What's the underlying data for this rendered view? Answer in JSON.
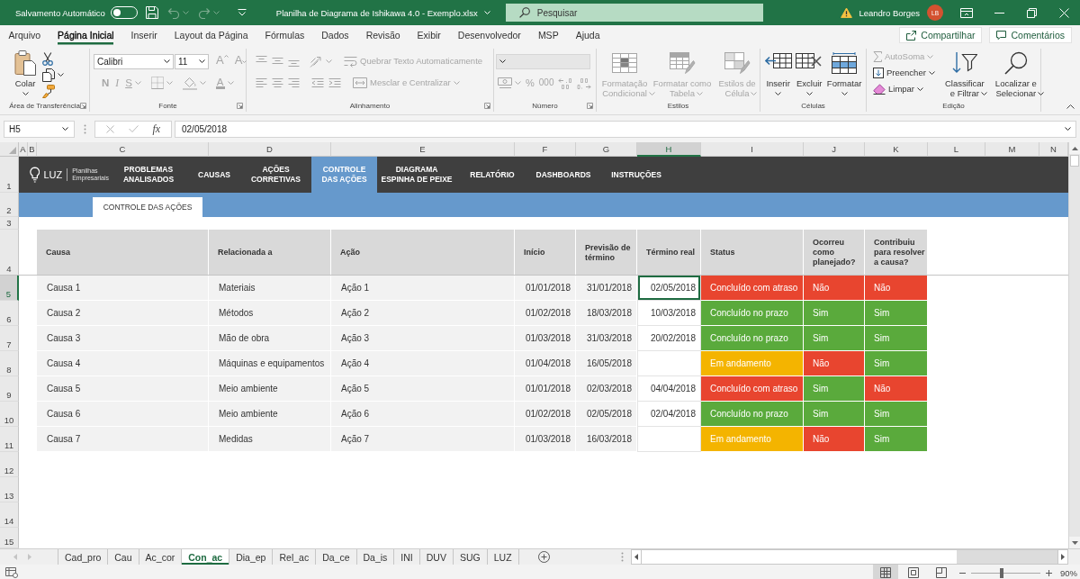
{
  "title_bar": {
    "autosave": {
      "label": "Salvamento Automático",
      "on": false
    },
    "quick_access": [
      {
        "kind": "save",
        "disabled": false
      },
      {
        "kind": "undo",
        "disabled": true
      },
      {
        "kind": "redo",
        "disabled": true
      },
      {
        "kind": "customize",
        "disabled": false
      }
    ],
    "title": "Planilha de Diagrama de Ishikawa 4.0 - Exemplo.xlsx",
    "search": {
      "placeholder": "Pesquisar"
    },
    "user": {
      "name": "Leandro Borges",
      "initials": "LB"
    }
  },
  "ribbon_tabs": [
    {
      "label": "Arquivo",
      "selected": false
    },
    {
      "label": "Página Inicial",
      "selected": true
    },
    {
      "label": "Inserir",
      "selected": false
    },
    {
      "label": "Layout da Página",
      "selected": false
    },
    {
      "label": "Fórmulas",
      "selected": false
    },
    {
      "label": "Dados",
      "selected": false
    },
    {
      "label": "Revisão",
      "selected": false
    },
    {
      "label": "Exibir",
      "selected": false
    },
    {
      "label": "Desenvolvedor",
      "selected": false
    },
    {
      "label": "MSP",
      "selected": false
    },
    {
      "label": "Ajuda",
      "selected": false
    }
  ],
  "share_button": "Compartilhar",
  "comments_button": "Comentários",
  "ribbon": {
    "groups": [
      {
        "kind": "stack",
        "label": "Área de Transferência",
        "launcher": true,
        "controls": [
          {
            "kind": "paste",
            "label": "Colar",
            "disabled": false
          },
          {
            "kind": "cut",
            "disabled": false
          },
          {
            "kind": "copy",
            "disabled": false
          },
          {
            "kind": "format-painter",
            "disabled": false
          }
        ]
      },
      {
        "kind": "rows",
        "label": "Fonte",
        "launcher": true,
        "controls": [
          {
            "kind": "font-name",
            "value": "Calibri",
            "disabled": false
          },
          {
            "kind": "font-size",
            "value": "11",
            "disabled": false
          },
          {
            "kind": "grow-font",
            "label": "A",
            "disabled": true
          },
          {
            "kind": "shrink-font",
            "label": "A",
            "disabled": true
          },
          {
            "kind": "bold",
            "label": "N",
            "disabled": true
          },
          {
            "kind": "italic",
            "label": "I",
            "disabled": true
          },
          {
            "kind": "underline",
            "label": "S",
            "disabled": true
          },
          {
            "kind": "borders",
            "disabled": true
          },
          {
            "kind": "fill-color",
            "disabled": true
          },
          {
            "kind": "font-color",
            "label": "A",
            "disabled": true
          }
        ]
      },
      {
        "kind": "rows",
        "label": "Alinhamento",
        "launcher": true,
        "controls": [
          {
            "kind": "align-top",
            "disabled": true
          },
          {
            "kind": "align-middle",
            "disabled": true
          },
          {
            "kind": "align-bottom",
            "disabled": true
          },
          {
            "kind": "orientation",
            "disabled": true
          },
          {
            "kind": "wrap-text",
            "label": "Quebrar Texto Automaticamente",
            "disabled": true
          },
          {
            "kind": "align-left",
            "disabled": true
          },
          {
            "kind": "align-center",
            "disabled": true
          },
          {
            "kind": "align-right",
            "disabled": true
          },
          {
            "kind": "indent-decrease",
            "disabled": true
          },
          {
            "kind": "indent-increase",
            "disabled": true
          },
          {
            "kind": "merge",
            "label": "Mesclar e Centralizar",
            "disabled": true
          }
        ]
      },
      {
        "kind": "rows",
        "label": "Número",
        "launcher": true,
        "controls": [
          {
            "kind": "number-format",
            "disabled": true
          },
          {
            "kind": "currency",
            "disabled": true
          },
          {
            "kind": "percent",
            "label": "%",
            "disabled": true
          },
          {
            "kind": "thousands",
            "label": "000",
            "disabled": true
          },
          {
            "kind": "decimal-increase",
            "disabled": true
          },
          {
            "kind": "decimal-decrease",
            "disabled": true
          }
        ]
      },
      {
        "kind": "stack",
        "label": "Estilos",
        "launcher": false,
        "controls": [
          {
            "kind": "cond-format",
            "label": "Formatação Condicional",
            "disabled": true
          },
          {
            "kind": "table-format",
            "label": "Formatar como Tabela",
            "disabled": true
          },
          {
            "kind": "cell-styles",
            "label": "Estilos de Célula",
            "disabled": true
          }
        ]
      },
      {
        "kind": "stack",
        "label": "Células",
        "launcher": false,
        "controls": [
          {
            "kind": "insert",
            "label": "Inserir",
            "disabled": false
          },
          {
            "kind": "delete",
            "label": "Excluir",
            "disabled": false
          },
          {
            "kind": "format",
            "label": "Formatar",
            "disabled": false
          }
        ]
      },
      {
        "kind": "stack",
        "label": "Edição",
        "launcher": false,
        "controls": [
          {
            "kind": "autosum",
            "label": "AutoSoma",
            "disabled": true
          },
          {
            "kind": "fill",
            "label": "Preencher",
            "disabled": false
          },
          {
            "kind": "clear",
            "label": "Limpar",
            "disabled": false
          },
          {
            "kind": "sort-filter",
            "label": "Classificar e Filtrar",
            "disabled": false
          },
          {
            "kind": "find",
            "label": "Localizar e Selecionar",
            "disabled": false
          }
        ]
      }
    ]
  },
  "formula_bar": {
    "name_box": "H5",
    "buttons": [
      {
        "kind": "cancel",
        "disabled": true
      },
      {
        "kind": "enter",
        "disabled": true
      },
      {
        "kind": "function",
        "label": "fx",
        "disabled": false
      }
    ],
    "value": "02/05/2018"
  },
  "sheet": {
    "columns": [
      {
        "label": "A",
        "selected": false
      },
      {
        "label": "B",
        "selected": false
      },
      {
        "label": "C",
        "selected": false
      },
      {
        "label": "D",
        "selected": false
      },
      {
        "label": "E",
        "selected": false
      },
      {
        "label": "F",
        "selected": false
      },
      {
        "label": "G",
        "selected": false
      },
      {
        "label": "H",
        "selected": true
      },
      {
        "label": "I",
        "selected": false
      },
      {
        "label": "J",
        "selected": false
      },
      {
        "label": "K",
        "selected": false
      },
      {
        "label": "L",
        "selected": false
      },
      {
        "label": "M",
        "selected": false
      },
      {
        "label": "N",
        "selected": false
      }
    ],
    "rows": [
      {
        "label": "1",
        "selected": false
      },
      {
        "label": "2",
        "selected": false
      },
      {
        "label": "3",
        "selected": false
      },
      {
        "label": "4",
        "selected": false
      },
      {
        "label": "5",
        "selected": true
      },
      {
        "label": "6",
        "selected": false
      },
      {
        "label": "7",
        "selected": false
      },
      {
        "label": "8",
        "selected": false
      },
      {
        "label": "9",
        "selected": false
      },
      {
        "label": "10",
        "selected": false
      },
      {
        "label": "11",
        "selected": false
      },
      {
        "label": "12",
        "selected": false
      },
      {
        "label": "13",
        "selected": false
      },
      {
        "label": "14",
        "selected": false
      },
      {
        "label": "15",
        "selected": false
      }
    ],
    "nav_bar": {
      "logo": {
        "name": "LUZ",
        "tagline": "Planilhas Empresariais"
      },
      "items": [
        {
          "label": "PROBLEMAS ANALISADOS",
          "selected": false
        },
        {
          "label": "CAUSAS",
          "selected": false
        },
        {
          "label": "AÇÕES CORRETIVAS",
          "selected": false
        },
        {
          "label": "CONTROLE DAS AÇÕES",
          "selected": true
        },
        {
          "label": "DIAGRAMA ESPINHA DE PEIXE",
          "selected": false
        },
        {
          "label": "RELATÓRIO",
          "selected": false
        },
        {
          "label": "DASHBOARDS",
          "selected": false
        },
        {
          "label": "INSTRUÇÕES",
          "selected": false
        }
      ]
    },
    "page_tab": "CONTROLE DAS AÇÕES",
    "table": {
      "columns": [
        "Causa",
        "Relacionada a",
        "Ação",
        "Início",
        "Previsão de término",
        "Término real",
        "Status",
        "Ocorreu como planejado?",
        "Contribuiu para resolver a causa?"
      ],
      "rows": [
        {
          "cause": "Causa 1",
          "related_to": "Materiais",
          "action": "Ação 1",
          "start": "01/01/2018",
          "forecast": "31/01/2018",
          "end": {
            "value": "02/05/2018",
            "selected": true
          },
          "status": {
            "text": "Concluído com atraso",
            "color": "#e8452f"
          },
          "as_planned": {
            "text": "Não",
            "color": "#e8452f"
          },
          "resolved": {
            "text": "Não",
            "color": "#e8452f"
          }
        },
        {
          "cause": "Causa 2",
          "related_to": "Métodos",
          "action": "Ação 2",
          "start": "01/02/2018",
          "forecast": "18/03/2018",
          "end": {
            "value": "10/03/2018",
            "selected": false
          },
          "status": {
            "text": "Concluído no prazo",
            "color": "#5aaa3c"
          },
          "as_planned": {
            "text": "Sim",
            "color": "#5aaa3c"
          },
          "resolved": {
            "text": "Sim",
            "color": "#5aaa3c"
          }
        },
        {
          "cause": "Causa 3",
          "related_to": "Mão de obra",
          "action": "Ação 3",
          "start": "01/03/2018",
          "forecast": "31/03/2018",
          "end": {
            "value": "20/02/2018",
            "selected": false
          },
          "status": {
            "text": "Concluído no prazo",
            "color": "#5aaa3c"
          },
          "as_planned": {
            "text": "Sim",
            "color": "#5aaa3c"
          },
          "resolved": {
            "text": "Sim",
            "color": "#5aaa3c"
          }
        },
        {
          "cause": "Causa 4",
          "related_to": "Máquinas e equipamentos",
          "action": "Ação 4",
          "start": "01/04/2018",
          "forecast": "16/05/2018",
          "end": {
            "selected": false
          },
          "status": {
            "text": "Em andamento",
            "color": "#f4b400"
          },
          "as_planned": {
            "text": "Não",
            "color": "#e8452f"
          },
          "resolved": {
            "text": "Sim",
            "color": "#5aaa3c"
          }
        },
        {
          "cause": "Causa 5",
          "related_to": "Meio ambiente",
          "action": "Ação 5",
          "start": "01/01/2018",
          "forecast": "02/03/2018",
          "end": {
            "value": "04/04/2018",
            "selected": false
          },
          "status": {
            "text": "Concluído com atraso",
            "color": "#e8452f"
          },
          "as_planned": {
            "text": "Sim",
            "color": "#5aaa3c"
          },
          "resolved": {
            "text": "Não",
            "color": "#e8452f"
          }
        },
        {
          "cause": "Causa 6",
          "related_to": "Meio ambiente",
          "action": "Ação 6",
          "start": "01/02/2018",
          "forecast": "02/05/2018",
          "end": {
            "value": "02/04/2018",
            "selected": false
          },
          "status": {
            "text": "Concluído no prazo",
            "color": "#5aaa3c"
          },
          "as_planned": {
            "text": "Sim",
            "color": "#5aaa3c"
          },
          "resolved": {
            "text": "Sim",
            "color": "#5aaa3c"
          }
        },
        {
          "cause": "Causa 7",
          "related_to": "Medidas",
          "action": "Ação 7",
          "start": "01/03/2018",
          "forecast": "16/03/2018",
          "end": {
            "selected": false
          },
          "status": {
            "text": "Em andamento",
            "color": "#f4b400"
          },
          "as_planned": {
            "text": "Não",
            "color": "#e8452f"
          },
          "resolved": {
            "text": "Sim",
            "color": "#5aaa3c"
          }
        }
      ]
    }
  },
  "sheet_tabs": {
    "nav": [
      {
        "kind": "previous",
        "disabled": true
      },
      {
        "kind": "next",
        "disabled": true
      }
    ],
    "tabs": [
      {
        "label": "Cad_pro",
        "selected": false
      },
      {
        "label": "Cau",
        "selected": false
      },
      {
        "label": "Ac_cor",
        "selected": false
      },
      {
        "label": "Con_ac",
        "selected": true
      },
      {
        "label": "Dia_ep",
        "selected": false
      },
      {
        "label": "Rel_ac",
        "selected": false
      },
      {
        "label": "Da_ce",
        "selected": false
      },
      {
        "label": "Da_is",
        "selected": false
      },
      {
        "label": "INI",
        "selected": false
      },
      {
        "label": "DUV",
        "selected": false
      },
      {
        "label": "SUG",
        "selected": false
      },
      {
        "label": "LUZ",
        "selected": false
      }
    ]
  },
  "status_bar": {
    "views": [
      {
        "kind": "normal",
        "selected": true
      },
      {
        "kind": "page-layout",
        "selected": false
      },
      {
        "kind": "page-break",
        "selected": false
      }
    ],
    "zoom": {
      "level": 0.44,
      "reading": "90%"
    }
  }
}
